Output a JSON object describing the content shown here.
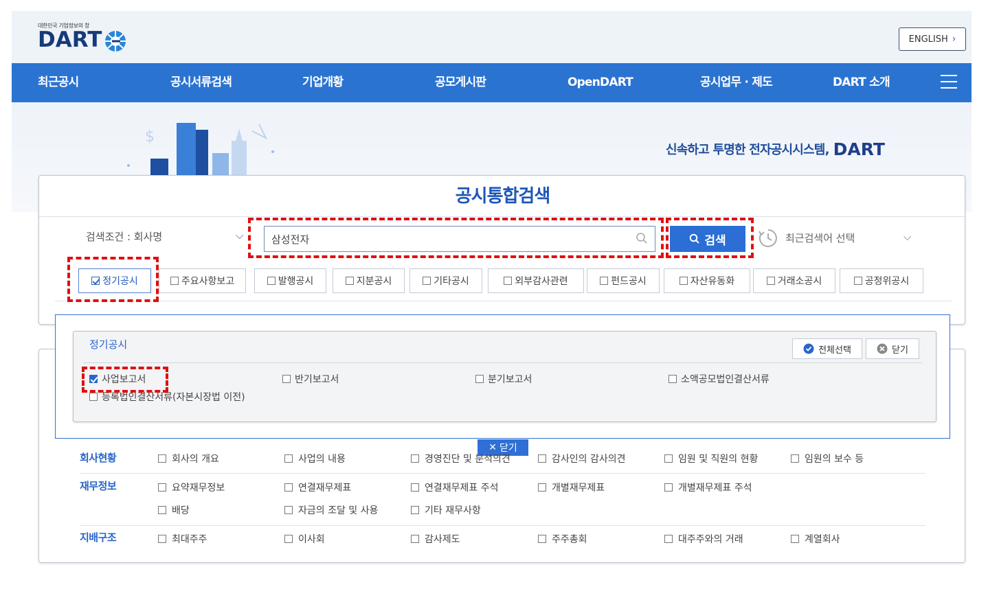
{
  "header": {
    "logo_small": "대한민국 기업정보의 창",
    "logo_text": "DART",
    "english_label": "ENGLISH"
  },
  "nav": {
    "items": [
      "최근공시",
      "공시서류검색",
      "기업개황",
      "공모게시판",
      "OpenDART",
      "공시업무 · 제도",
      "DART 소개"
    ]
  },
  "banner": {
    "slogan": "신속하고 투명한 전자공시시스템,",
    "slogan_brand": "DART"
  },
  "search": {
    "title": "공시통합검색",
    "condition_label": "검색조건 : 회사명",
    "query": "삼성전자",
    "button_label": "검색",
    "recent_label": "최근검색어 선택"
  },
  "filter_tabs": [
    {
      "label": "정기공시",
      "checked": true
    },
    {
      "label": "주요사항보고",
      "checked": false
    },
    {
      "label": "발행공시",
      "checked": false
    },
    {
      "label": "지분공시",
      "checked": false
    },
    {
      "label": "기타공시",
      "checked": false
    },
    {
      "label": "외부감사관련",
      "checked": false
    },
    {
      "label": "펀드공시",
      "checked": false
    },
    {
      "label": "자산유동화",
      "checked": false
    },
    {
      "label": "거래소공시",
      "checked": false
    },
    {
      "label": "공정위공시",
      "checked": false
    }
  ],
  "regular_panel": {
    "title": "정기공시",
    "select_all_label": "전체선택",
    "close_label": "닫기",
    "options": [
      {
        "label": "사업보고서",
        "checked": true
      },
      {
        "label": "반기보고서",
        "checked": false
      },
      {
        "label": "분기보고서",
        "checked": false
      },
      {
        "label": "소액공모법인결산서류",
        "checked": false
      },
      {
        "label": "등록법인결산서류(자본시장법 이전)",
        "checked": false
      }
    ],
    "layer_close_label": "닫기"
  },
  "detail_rows": [
    {
      "label": "회사현황",
      "options": [
        "회사의 개요",
        "사업의 내용",
        "경영진단 및 분석의견",
        "감사인의 감사의견",
        "임원 및 직원의 현황",
        "임원의 보수 등"
      ]
    },
    {
      "label": "재무정보",
      "options": [
        "요약재무정보",
        "연결재무제표",
        "연결재무제표 주석",
        "개별재무제표",
        "개별재무제표 주석",
        "배당",
        "자금의 조달 및 사용",
        "기타 재무사항"
      ]
    },
    {
      "label": "지배구조",
      "options": [
        "최대주주",
        "이사회",
        "감사제도",
        "주주총회",
        "대주주와의 거래",
        "계열회사"
      ]
    }
  ],
  "colors": {
    "primary": "#2b73d1",
    "highlight": "#e01010",
    "title_blue": "#1e57b8"
  }
}
